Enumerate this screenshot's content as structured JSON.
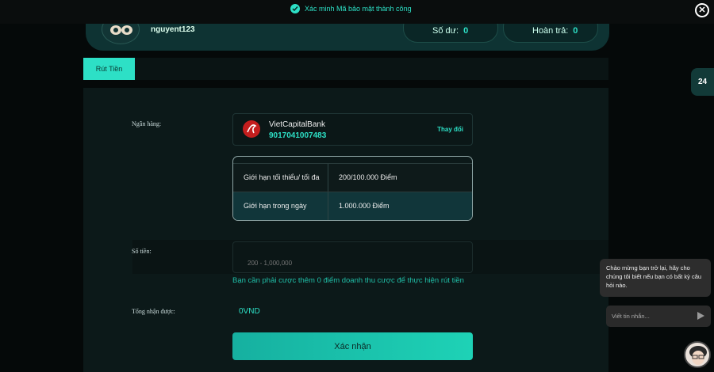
{
  "toast": {
    "message": "Xác minh Mã bảo mật thành công"
  },
  "profile": {
    "username": "nguyent123",
    "balance_label": "Số dư:",
    "balance_value": "0",
    "refund_label": "Hoàn trả:",
    "refund_value": "0"
  },
  "tabs": {
    "active_label": "Rút Tiền"
  },
  "form": {
    "bank_label": "Ngân hàng:",
    "bank": {
      "name": "VietCapitalBank",
      "account": "9017041007483",
      "change_label": "Thay đổi"
    },
    "limits": [
      {
        "label": "Giới hạn tối thiểu/ tối đa",
        "value": "200/100.000 Điểm"
      },
      {
        "label": "Giới hạn trong ngày",
        "value": "1.000.000 Điểm"
      }
    ],
    "amount_label": "Số tiền:",
    "amount_placeholder": "200 - 1,000,000",
    "hint": "Bạn cần phải cược thêm 0 điểm doanh thu cược để thực hiện rút tiền",
    "total_label": "Tổng nhận được:",
    "total_value": "0VND",
    "submit_label": "Xác nhận"
  },
  "support": {
    "label": "24"
  },
  "chat": {
    "greeting": "Chào mừng bạn trở lại, hãy cho chúng tôi biết nếu bạn có bất kỳ câu hỏi nào.",
    "input_placeholder": "Viết tin nhắn..."
  },
  "colors": {
    "accent": "#2de0c6",
    "background": "#050909",
    "panel": "#0c1919"
  }
}
